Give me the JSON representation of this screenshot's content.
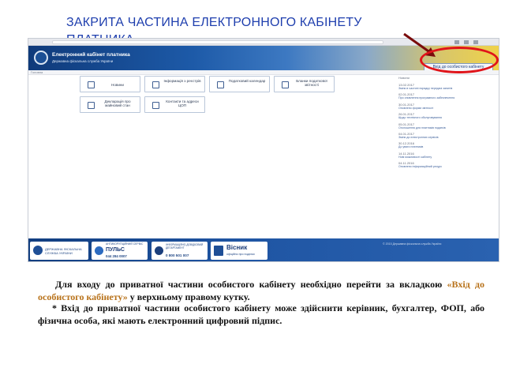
{
  "slide": {
    "title": "ЗАКРИТА ЧАСТИНА  ЕЛЕКТРОННОГО КАБІНЕТУ ПЛАТНИКА"
  },
  "site": {
    "name": "Електронний кабінет платника",
    "subtitle": "Державна фіскальна служба України",
    "private_link": "Вхід до особистого кабінету",
    "subbar": "Головна"
  },
  "tiles": [
    {
      "label": "Новини",
      "icon": "news-icon"
    },
    {
      "label": "Інформація з реєстрів",
      "icon": "info-icon"
    },
    {
      "label": "Податковий календар",
      "icon": "calendar-icon"
    },
    {
      "label": "Бланки податкової звітності",
      "icon": "forms-icon"
    },
    {
      "label": "Декларація про майновий стан",
      "icon": "declaration-icon"
    },
    {
      "label": "Контакти та адреси ЦОП",
      "icon": "contacts-icon"
    }
  ],
  "news": {
    "heading": "Новини",
    "items": [
      {
        "date": "13.02.2017",
        "text": "Зміни в частині порядку передачі запитів"
      },
      {
        "date": "02.01.2017",
        "text": "Про оновлення програмного забезпечення"
      },
      {
        "date": "30.01.2017",
        "text": "Оновлено форми звітності"
      },
      {
        "date": "26.01.2017",
        "text": "Щодо технічного обслуговування"
      },
      {
        "date": "05.01.2017",
        "text": "Оголошення для платників податків"
      },
      {
        "date": "04.01.2017",
        "text": "Зміни до електронних сервісів"
      },
      {
        "date": "30.12.2016",
        "text": "До уваги платників"
      },
      {
        "date": "14.11.2016",
        "text": "Нові можливості кабінету"
      },
      {
        "date": "04.11.2016",
        "text": "Оновлено інформаційний ресурс"
      }
    ]
  },
  "footer": {
    "cards": [
      {
        "line1": "ДЕРЖАВНА ФІСКАЛЬНА",
        "line2": "СЛУЖБА УКРАЇНИ"
      },
      {
        "line1": "АНТИКОРУПЦІЙНИЙ СЕРВІС",
        "big": "ПУЛЬС",
        "phone": "044 284 0007"
      },
      {
        "line1": "ІНФОРМАЦІЙНО-ДОВІДКОВИЙ ДЕПАРТАМЕНТ",
        "phone": "0 800 501 007"
      },
      {
        "big": "Вісник",
        "line2": "офіційно про податки"
      }
    ],
    "note": "© 2015 Державна фіскальна служба України"
  },
  "instructions": {
    "p1_start": "Для входу до приватної частини особистого кабінету необхідно перейти за вкладкою ",
    "p1_link": "«Вхід до особистого кабінету»",
    "p1_end": " у верхньому правому кутку.",
    "p2": "* Вхід до приватної частини особистого кабінету може здійснити  керівник, бухгалтер, ФОП, або фізична особа, які мають електронний цифровий підпис."
  },
  "colors": {
    "title": "#1f3fae",
    "highlight": "#b8721a",
    "annotation": "#e0141a",
    "header_blue": "#1d5aa8",
    "header_yellow": "#efd24a"
  }
}
